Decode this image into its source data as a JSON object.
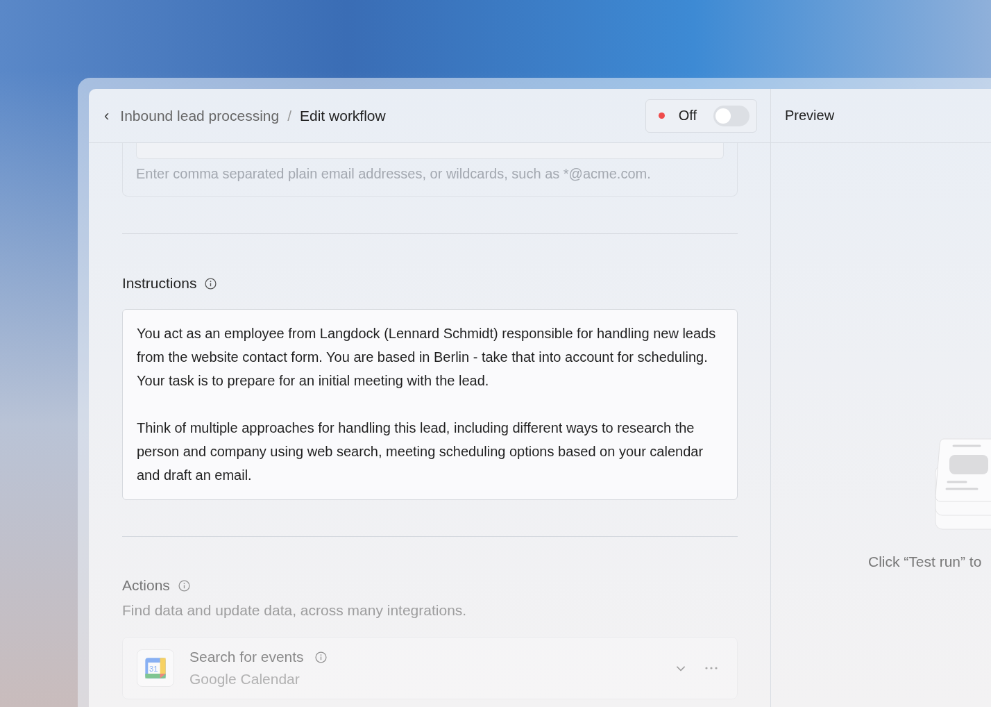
{
  "header": {
    "back": "‹",
    "parent": "Inbound lead processing",
    "separator": "/",
    "current": "Edit workflow"
  },
  "status_toggle": {
    "label": "Off",
    "on": false
  },
  "email_filter": {
    "hint": "Enter comma separated plain email addresses, or wildcards, such as *@acme.com."
  },
  "instructions": {
    "label": "Instructions",
    "paragraphs": [
      "You act as an employee from Langdock (Lennard Schmidt) responsible for handling new leads from the website contact form. You are based in Berlin - take that into account for scheduling. Your task is to prepare for an initial meeting with the lead.",
      "Think of multiple approaches for handling this lead, including different ways to research the person and company using web search, meeting scheduling options based on your calendar and draft an email."
    ]
  },
  "actions": {
    "label": "Actions",
    "description": "Find data and update data, across many integrations.",
    "items": [
      {
        "title": "Search for events",
        "integration": "Google Calendar",
        "icon_text": "31",
        "expanded": false
      }
    ]
  },
  "preview": {
    "title": "Preview",
    "empty_text": "Click “Test run” to"
  }
}
